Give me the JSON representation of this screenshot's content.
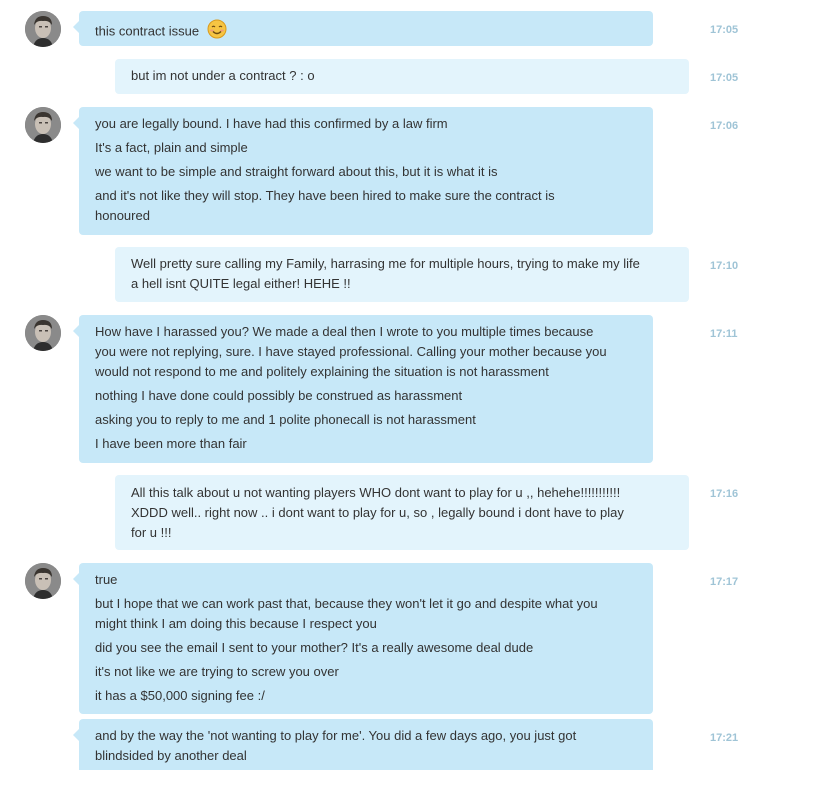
{
  "messages": [
    {
      "time": "17:05",
      "lines": [
        "this contract issue"
      ],
      "emoji": "smiling-blush-emoji"
    },
    {
      "time": "17:05",
      "lines": [
        "but im not under a contract ? : o"
      ]
    },
    {
      "time": "17:06",
      "lines": [
        "you are legally bound. I have had this confirmed by a law firm",
        "It's a fact, plain and simple",
        "we want to be simple and straight forward about this, but it is what it is",
        "and it's not like they will stop. They have been hired to make sure the contract is",
        "honoured"
      ]
    },
    {
      "time": "17:10",
      "lines": [
        "Well pretty sure calling my Family, harrasing me for multiple hours, trying to make my life",
        "a hell isnt QUITE legal either! HEHE !!"
      ]
    },
    {
      "time": "17:11",
      "lines": [
        "How have I harassed you? We made a deal then I wrote to you multiple times because",
        "you were not replying, sure. I have stayed professional. Calling your mother because you",
        "would not respond to me and politely explaining the situation is not harassment",
        "nothing I have done could possibly be construed as harassment",
        "asking you to reply to me and 1 polite phonecall is not harassment",
        "I have been more than fair"
      ]
    },
    {
      "time": "17:16",
      "lines": [
        "All this talk about u not wanting players WHO dont want to play for u ,, hehehe!!!!!!!!!!!",
        "XDDD well.. right now .. i dont want to play for u, so , legally bound i dont have to play",
        "for u !!!"
      ]
    },
    {
      "time": "17:17",
      "lines": [
        "true",
        "but I hope that we can work past that, because they won't let it go and despite what you",
        "might think I am doing this because I respect you",
        "did you see the email I sent to your mother? It's a really awesome deal dude",
        "it's not like we are trying to screw you over",
        "it has a $50,000 signing fee :/"
      ]
    },
    {
      "time": "17:21",
      "lines": [
        "and by the way the 'not wanting to play for me'. You did a few days ago, you just got",
        "blindsided by another deal"
      ]
    }
  ]
}
